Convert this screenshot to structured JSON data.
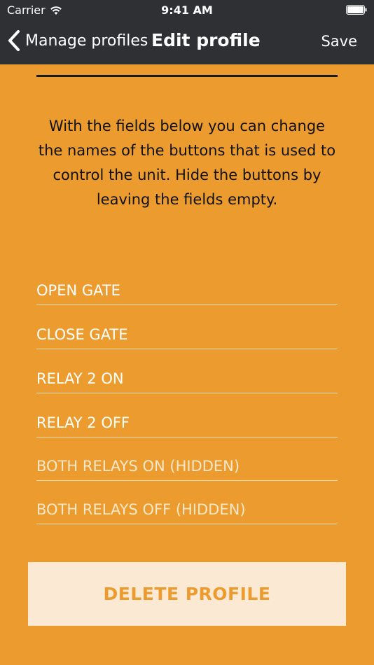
{
  "status_bar": {
    "carrier": "Carrier",
    "time": "9:41 AM"
  },
  "nav": {
    "back_label": "Manage profiles",
    "title": "Edit profile",
    "save_label": "Save"
  },
  "description": "With the fields below you can change the names of the buttons that is used to control the unit. Hide the buttons by leaving the fields empty.",
  "fields": [
    {
      "value": "OPEN GATE",
      "placeholder": ""
    },
    {
      "value": "CLOSE GATE",
      "placeholder": ""
    },
    {
      "value": "RELAY 2 ON",
      "placeholder": ""
    },
    {
      "value": "RELAY 2 OFF",
      "placeholder": ""
    },
    {
      "value": "",
      "placeholder": "BOTH RELAYS ON (HIDDEN)"
    },
    {
      "value": "",
      "placeholder": "BOTH RELAYS OFF (HIDDEN)"
    }
  ],
  "delete_label": "DELETE PROFILE",
  "colors": {
    "background": "#EC9C2F",
    "header": "#2F3034",
    "delete_button_bg": "#FBE9D4"
  },
  "icons": [
    "wifi-icon",
    "battery-icon",
    "back-chevron-icon"
  ]
}
